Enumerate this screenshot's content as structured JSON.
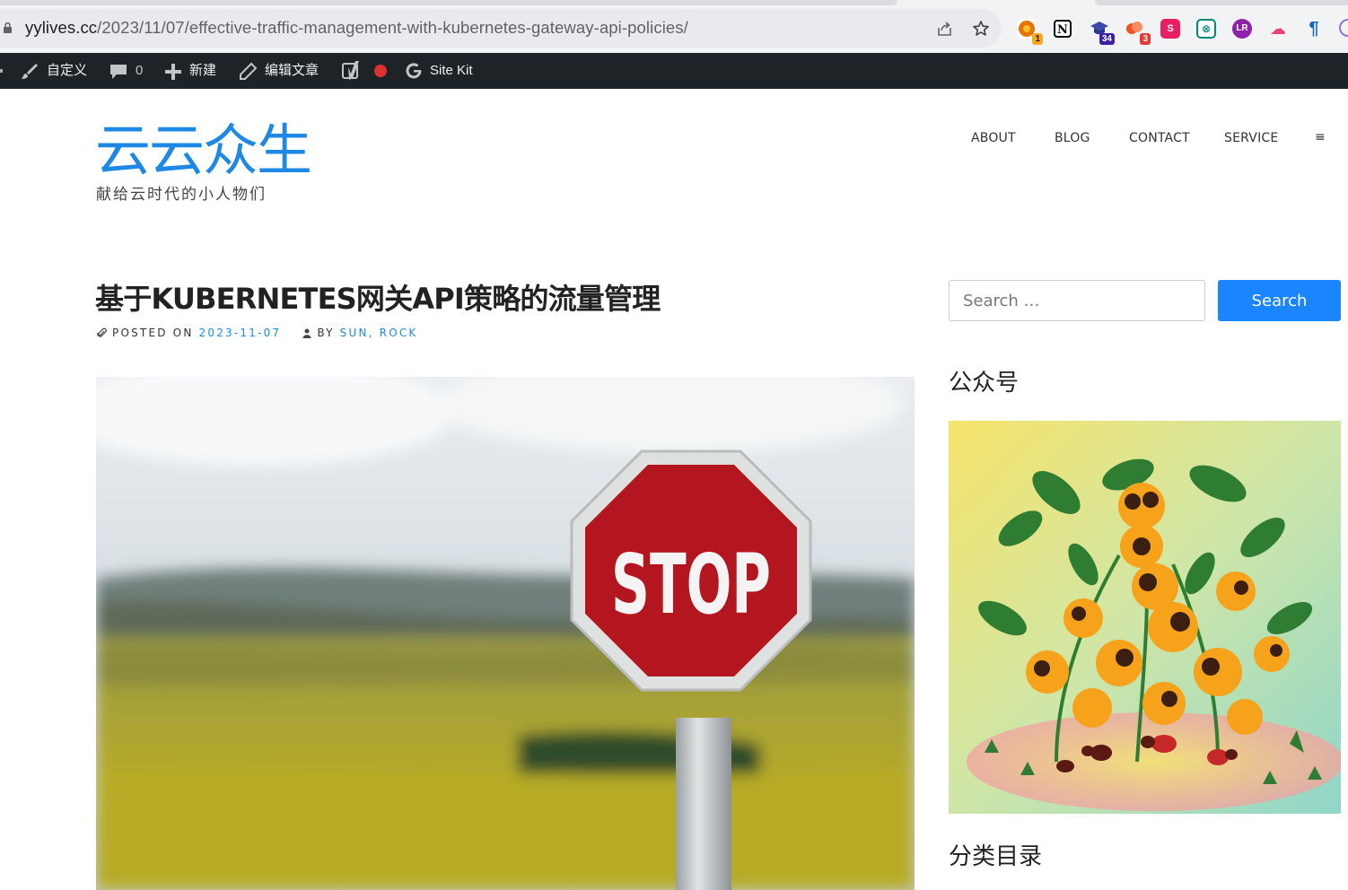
{
  "browser": {
    "url_host": "yylives.cc",
    "url_path": "/2023/11/07/effective-traffic-management-with-kubernetes-gateway-api-policies/",
    "extensions": [
      {
        "name": "ext-chrome-icon",
        "badge": "1",
        "color": "#e8710a"
      },
      {
        "name": "notion-icon",
        "badge": "",
        "color": "#000000"
      },
      {
        "name": "graduation-cap-icon",
        "badge": "34",
        "color": "#3c1fa8"
      },
      {
        "name": "ext-red-icon",
        "badge": "3",
        "color": "#e53935"
      },
      {
        "name": "ext-pink-icon",
        "badge": "",
        "color": "#e91e63"
      },
      {
        "name": "ext-teal-icon",
        "badge": "",
        "color": "#00897b"
      },
      {
        "name": "ext-purple-icon",
        "badge": "",
        "color": "#8e24aa"
      },
      {
        "name": "ext-cloud-icon",
        "badge": "",
        "color": "#ec407a"
      },
      {
        "name": "ext-blue-icon",
        "badge": "",
        "color": "#1565c0"
      }
    ]
  },
  "adminbar": {
    "customize": "自定义",
    "comments_count": "0",
    "new": "新建",
    "edit": "编辑文章",
    "sitekit": "Site Kit"
  },
  "site": {
    "title": "云云众生",
    "description": "献给云时代的小人物们"
  },
  "nav": {
    "items": [
      "ABOUT",
      "BLOG",
      "CONTACT",
      "SERVICE"
    ],
    "menu_symbol": "≡"
  },
  "post": {
    "title": "基于KUBERNETES网关API策略的流量管理",
    "posted_on_label": "POSTED ON",
    "date": "2023-11-07",
    "by_label": "BY",
    "author": "SUN, ROCK",
    "image_sign_text": "STOP"
  },
  "sidebar": {
    "search_placeholder": "Search …",
    "search_button": "Search",
    "widget1_title": "公众号",
    "widget2_title": "分类目录"
  },
  "colors": {
    "accent": "#1e88e5",
    "button": "#1a85ff",
    "adminbar": "#1d2327"
  }
}
